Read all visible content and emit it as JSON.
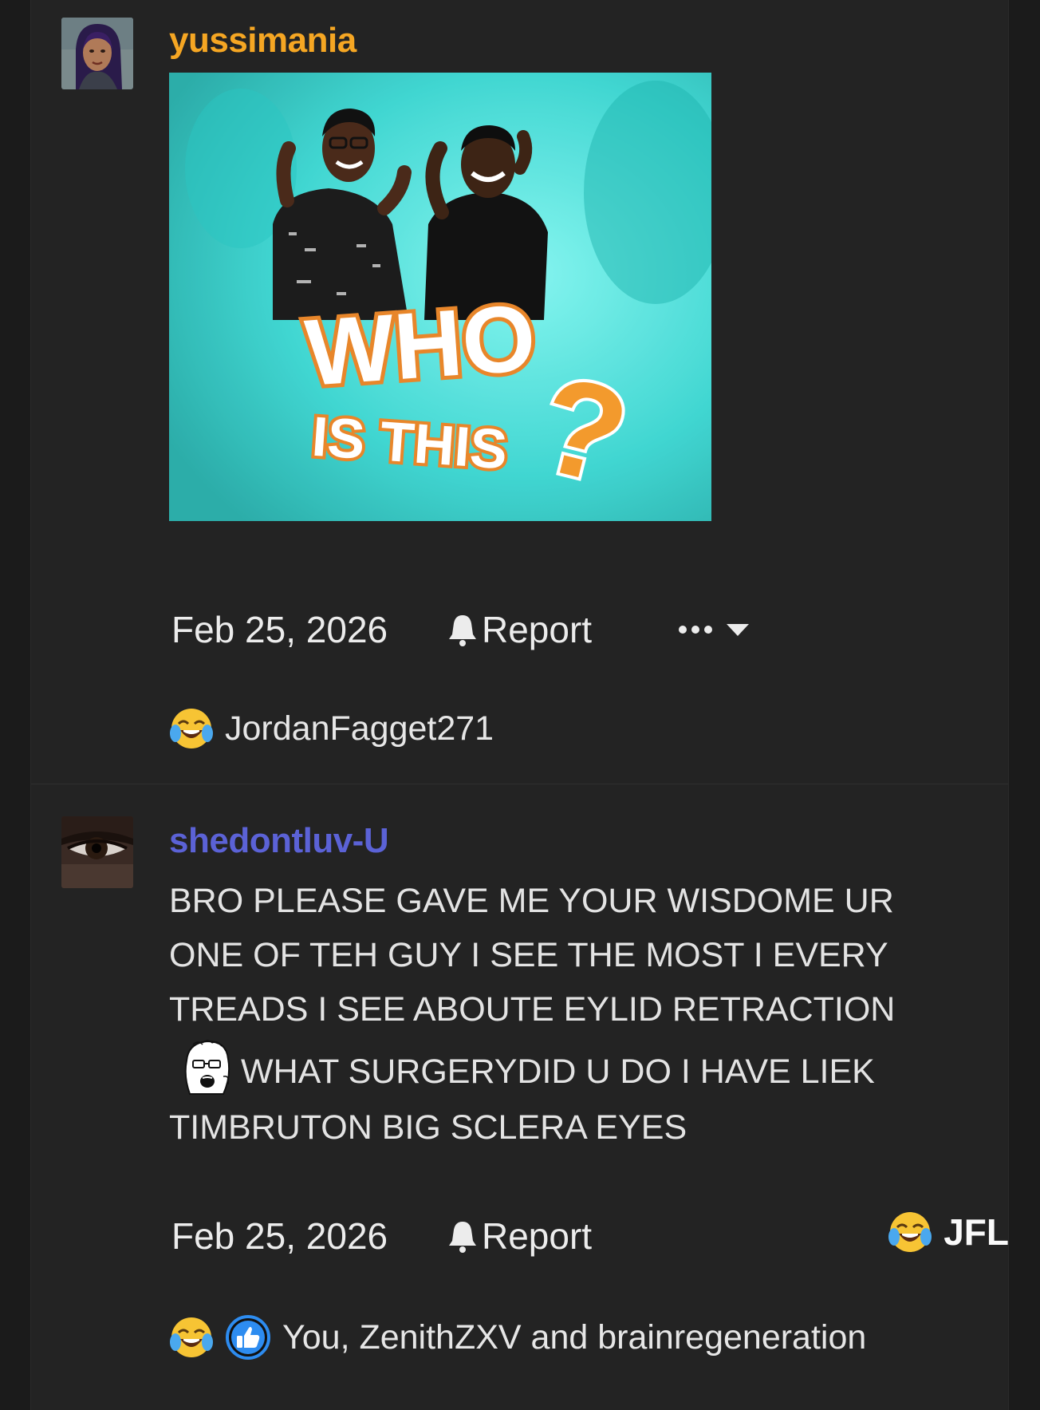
{
  "posts": [
    {
      "username": "yussimania",
      "username_color": "#f5a623",
      "avatar_icon": "woman-portrait-avatar",
      "image": {
        "caption_line1": "WHO",
        "caption_line2": "IS THIS",
        "caption_mark": "?"
      },
      "date": "Feb 25, 2026",
      "report_label": "Report",
      "more_icon": "ellipsis-dropdown-icon",
      "reactions": {
        "emoji": "crying-laughing-emoji",
        "users": "JordanFagget271"
      }
    },
    {
      "username": "shedontluv-U",
      "username_color": "#5b62d6",
      "avatar_icon": "eye-closeup-avatar",
      "message_lines": [
        "BRO PLEASE GAVE ME YOUR WISDOME UR",
        "ONE OF TEH GUY I SEE THE MOST I EVERY",
        "TREADS I SEE ABOUTE EYLID RETRACTION",
        "WHAT SURGERYDID U DO I HAVE LIEK",
        "TIMBRUTON BIG SCLERA EYES"
      ],
      "inline_emote": "soyjak-emote",
      "date": "Feb 25, 2026",
      "report_label": "Report",
      "react_label": "JFL",
      "reactions": {
        "emoji": "crying-laughing-emoji",
        "secondary_icon": "thumbs-up-icon",
        "users": "You, ZenithZXV and brainregeneration"
      }
    }
  ]
}
